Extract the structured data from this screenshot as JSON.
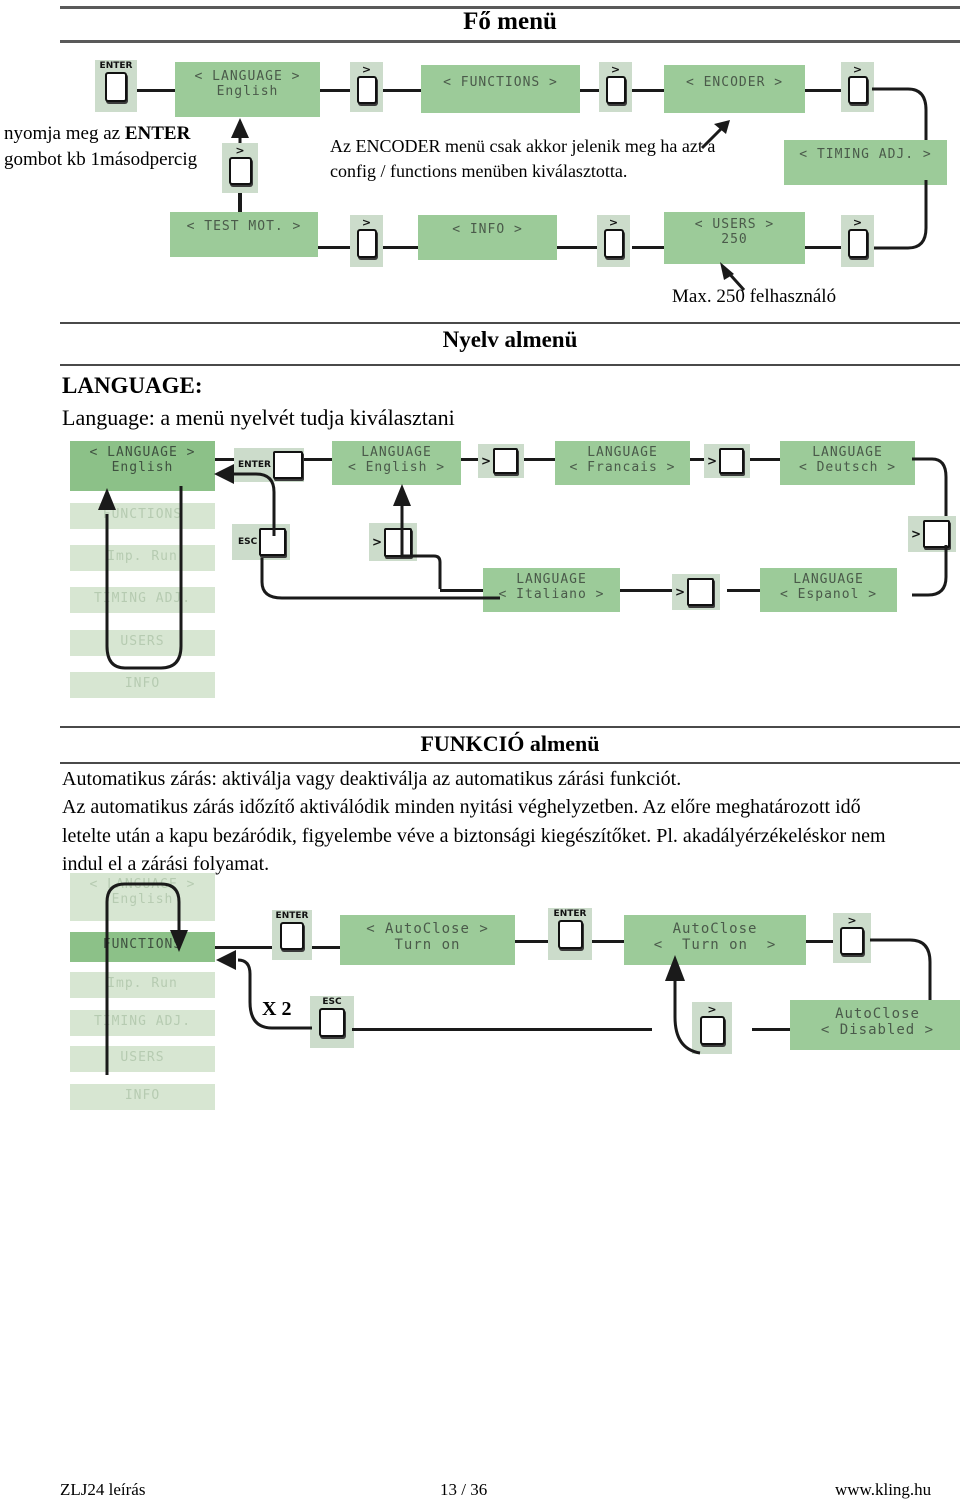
{
  "sections": {
    "main_menu": {
      "title": "Fő menü"
    },
    "language_menu": {
      "title": "Nyelv almenü"
    },
    "function_menu": {
      "title": "FUNKCIÓ almenü"
    }
  },
  "notes": {
    "enter_note_line1_pre": "nyomja meg az ",
    "enter_note_line1_bold": "ENTER",
    "enter_note_line2": "gombot kb 1másodpercig",
    "encoder_note_line1": "Az ENCODER menü csak akkor jelenik meg ha azt a",
    "encoder_note_line2": "config / functions menüben kiválasztotta.",
    "users_note": "Max. 250 felhasználó"
  },
  "language_text": {
    "heading": "LANGUAGE:",
    "subtitle": "Language: a menü nyelvét tudja kiválasztani"
  },
  "function_text": {
    "line1": "Automatikus zárás: aktiválja vagy deaktiválja az automatikus zárási funkciót.",
    "line2": "Az automatikus zárás időzítő aktiválódik minden nyitási véghelyzetben. Az előre meghatározott idő",
    "line3": "letelte után a kapu bezáródik, figyelembe véve a biztonsági kiegészítőket. Pl. akadályérzékeléskor nem",
    "line4": "indul el a zárási folyamat."
  },
  "main_diagram": {
    "buttons": {
      "enter": "ENTER",
      "next": ">"
    },
    "screens": [
      {
        "id": "language",
        "l1": "< LANGUAGE >",
        "l2": "English"
      },
      {
        "id": "functions",
        "l1": "< FUNCTIONS >",
        "l2": ""
      },
      {
        "id": "encoder",
        "l1": "< ENCODER >",
        "l2": ""
      },
      {
        "id": "timing_adj",
        "l1": "< TIMING ADJ. >",
        "l2": ""
      },
      {
        "id": "users",
        "l1": "< USERS >",
        "l2": "250"
      },
      {
        "id": "info",
        "l1": "< INFO >",
        "l2": ""
      },
      {
        "id": "test_mot",
        "l1": "< TEST MOT. >",
        "l2": ""
      }
    ]
  },
  "language_diagram": {
    "buttons": {
      "enter": "ENTER",
      "esc": "ESC",
      "next": ">"
    },
    "menu_list": [
      {
        "id": "language",
        "l1": "< LANGUAGE >",
        "l2": "English",
        "state": "selected"
      },
      {
        "id": "functions",
        "l1": "FUNCTIONS",
        "l2": "",
        "state": "faded"
      },
      {
        "id": "imp_run",
        "l1": "Imp. Run",
        "l2": "",
        "state": "faded"
      },
      {
        "id": "timing_adj",
        "l1": "TIMING ADJ.",
        "l2": "",
        "state": "faded"
      },
      {
        "id": "users",
        "l1": "USERS",
        "l2": "",
        "state": "faded"
      },
      {
        "id": "info",
        "l1": "INFO",
        "l2": "",
        "state": "faded"
      }
    ],
    "options": [
      {
        "id": "english",
        "l1": "LANGUAGE",
        "l2": "< English >"
      },
      {
        "id": "francais",
        "l1": "LANGUAGE",
        "l2": "< Francais >"
      },
      {
        "id": "deutsch",
        "l1": "LANGUAGE",
        "l2": "< Deutsch >"
      },
      {
        "id": "espanol",
        "l1": "LANGUAGE",
        "l2": "< Espanol >"
      },
      {
        "id": "italiano",
        "l1": "LANGUAGE",
        "l2": "< Italiano >"
      }
    ]
  },
  "function_diagram": {
    "buttons": {
      "enter": "ENTER",
      "esc": "ESC",
      "next": ">"
    },
    "esc_multiplier": "X 2",
    "menu_list": [
      {
        "id": "language",
        "l1": "< LANGUAGE >",
        "l2": "English",
        "state": "faded"
      },
      {
        "id": "functions",
        "l1": "FUNCTIONS",
        "l2": "",
        "state": "selected"
      },
      {
        "id": "imp_run",
        "l1": "Imp. Run",
        "l2": "",
        "state": "faded"
      },
      {
        "id": "timing_adj",
        "l1": "TIMING ADJ.",
        "l2": "",
        "state": "faded"
      },
      {
        "id": "users",
        "l1": "USERS",
        "l2": "",
        "state": "faded"
      },
      {
        "id": "info",
        "l1": "INFO",
        "l2": "",
        "state": "faded"
      }
    ],
    "screens": [
      {
        "id": "autoclose_entry",
        "l1": "< AutoClose >",
        "l2": "Turn on"
      },
      {
        "id": "autoclose_turn_on",
        "l1": "AutoClose",
        "l2": "<  Turn on  >"
      },
      {
        "id": "autoclose_disabled",
        "l1": "AutoClose",
        "l2": "< Disabled >"
      }
    ]
  },
  "footer": {
    "left": "ZLJ24 leírás",
    "center": "13 / 36",
    "right": "www.kling.hu"
  }
}
